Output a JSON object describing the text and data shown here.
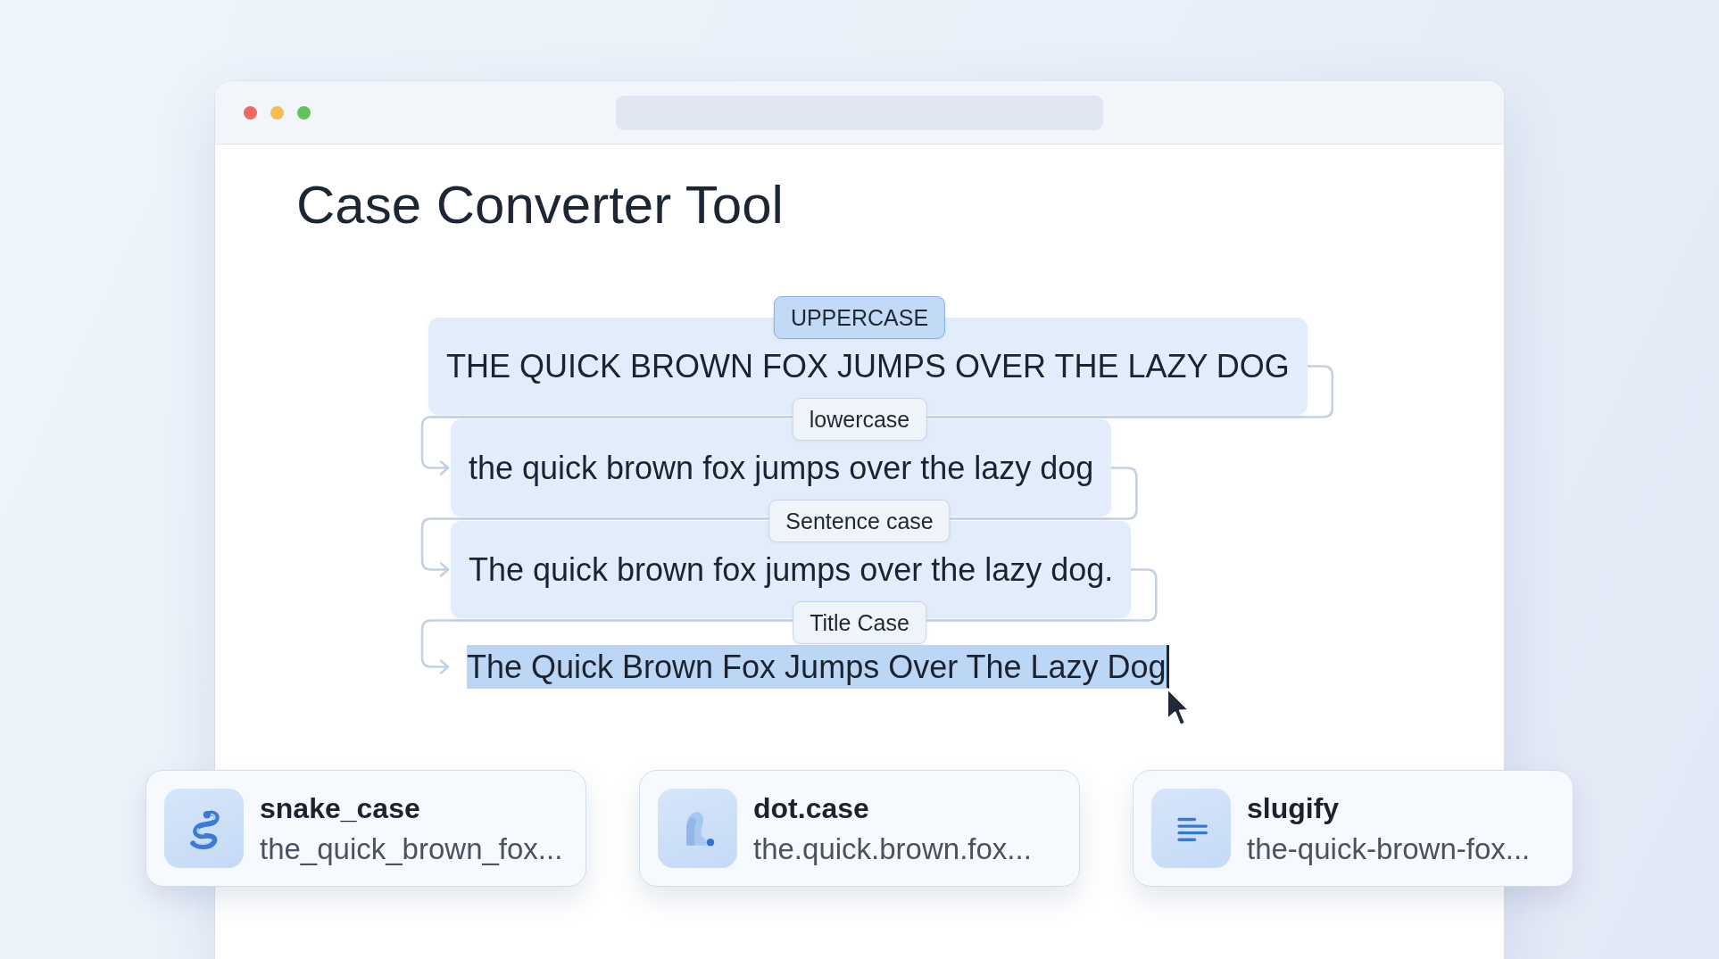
{
  "window": {
    "controls": [
      {
        "color": "#ee6a5f"
      },
      {
        "color": "#f5bd4f"
      },
      {
        "color": "#61c454"
      }
    ]
  },
  "title": "Case Converter Tool",
  "conversions": [
    {
      "label": "UPPERCASE",
      "selected": true,
      "kind": "box",
      "text": "THE QUICK BROWN FOX JUMPS OVER THE LAZY DOG",
      "text_selected": false,
      "caret": false
    },
    {
      "label": "lowercase",
      "selected": false,
      "kind": "box",
      "text": "the quick brown fox jumps over the lazy dog",
      "text_selected": false,
      "caret": false
    },
    {
      "label": "Sentence case",
      "selected": false,
      "kind": "box",
      "text": "The quick brown fox jumps over the lazy dog.",
      "text_selected": false,
      "caret": false
    },
    {
      "label": "Title Case",
      "selected": false,
      "kind": "inline",
      "text": "The Quick Brown Fox Jumps Over The Lazy Dog",
      "text_selected": true,
      "caret": true
    }
  ],
  "formats": [
    {
      "kind": "snake",
      "name": "snake_case",
      "preview": "the_quick_brown_fox..."
    },
    {
      "kind": "dot",
      "name": "dot.case",
      "preview": "the.quick.brown.fox..."
    },
    {
      "kind": "lines",
      "name": "slugify",
      "preview": "the-quick-brown-fox..."
    }
  ]
}
